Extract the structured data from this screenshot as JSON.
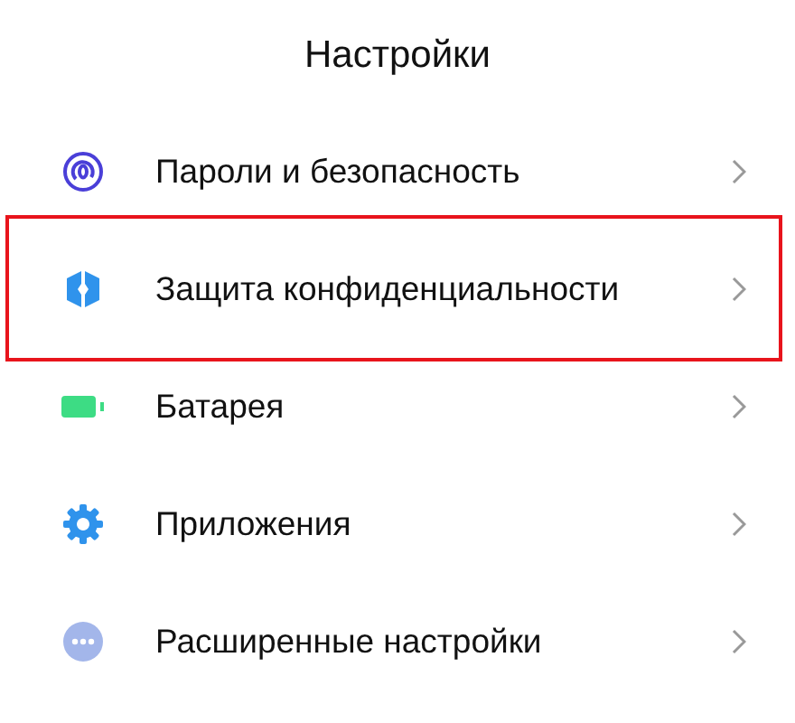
{
  "title": "Настройки",
  "items": [
    {
      "label": "Пароли и безопасность",
      "highlighted": false
    },
    {
      "label": "Защита конфиденциальности",
      "highlighted": true
    },
    {
      "label": "Батарея",
      "highlighted": false
    },
    {
      "label": "Приложения",
      "highlighted": false
    },
    {
      "label": "Расширенные настройки",
      "highlighted": false
    }
  ]
}
